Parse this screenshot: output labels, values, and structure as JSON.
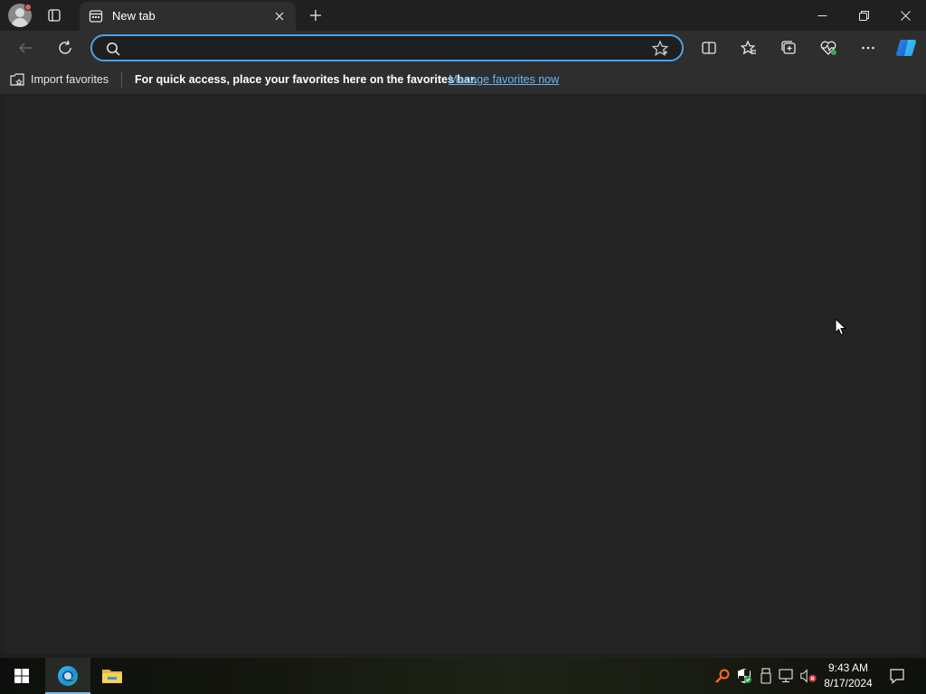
{
  "browser": {
    "tab": {
      "title": "New tab"
    },
    "address_bar": {
      "value": "",
      "placeholder": ""
    },
    "favorites_bar": {
      "import_label": "Import favorites",
      "message": "For quick access, place your favorites here on the favorites bar.",
      "manage_link": "Manage favorites now"
    },
    "icons": {
      "profile": "profile-avatar-icon",
      "tab_actions": "tab-actions-icon",
      "tab_favicon": "new-tab-page-icon",
      "tab_close": "close-icon",
      "new_tab": "plus-icon",
      "back": "back-arrow-icon",
      "refresh": "refresh-icon",
      "search": "search-icon",
      "favorite_star": "star-icon",
      "split_screen": "split-screen-icon",
      "favorites": "favorites-icon",
      "collections": "collections-icon",
      "browser_essentials": "heart-pulse-icon",
      "more": "more-icon",
      "copilot": "copilot-icon"
    },
    "accent_color": "#4aa3e8",
    "link_color": "#6cb4f0"
  },
  "taskbar": {
    "clock": {
      "time": "9:43 AM",
      "date": "8/17/2024"
    },
    "apps": [
      {
        "name": "Microsoft Edge",
        "icon": "edge-icon",
        "active": true
      },
      {
        "name": "File Explorer",
        "icon": "folder-icon",
        "active": false
      }
    ],
    "tray_icons": [
      "search-key-icon",
      "security-shield-icon",
      "usb-icon",
      "network-icon",
      "volume-muted-icon"
    ]
  }
}
